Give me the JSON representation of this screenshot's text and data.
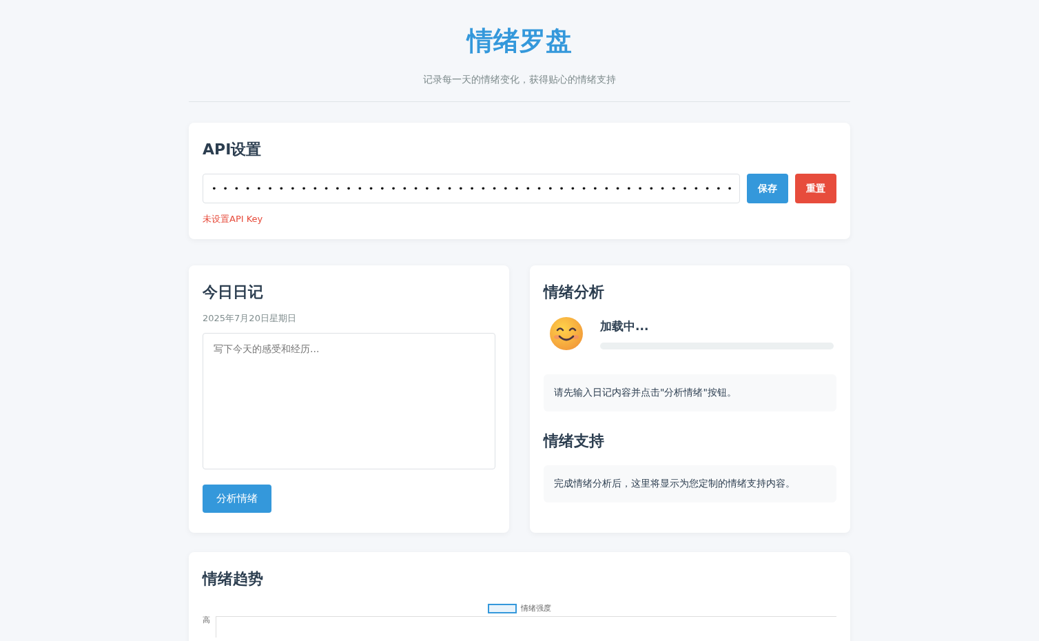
{
  "header": {
    "title": "情绪罗盘",
    "subtitle": "记录每一天的情绪变化，获得贴心的情绪支持"
  },
  "api_settings": {
    "title": "API设置",
    "key_field": {
      "value": "•••••••••••••••••••••••••••••••••••••••••••••••"
    },
    "buttons": [
      {
        "label": "保存",
        "kind": "primary"
      },
      {
        "label": "重置",
        "kind": "danger"
      }
    ],
    "status": "未设置API Key"
  },
  "diary": {
    "title": "今日日记",
    "date": "2025年7月20日星期日",
    "entry": {
      "placeholder": "写下今天的感受和经历..."
    },
    "button": "分析情绪"
  },
  "analysis": {
    "title": "情绪分析",
    "mood_label": "加载中...",
    "level": 0,
    "message": "请先输入日记内容并点击\"分析情绪\"按钮。"
  },
  "support": {
    "title": "情绪支持",
    "message": "完成情绪分析后，这里将显示为您定制的情绪支持内容。"
  },
  "trend": {
    "title": "情绪趋势",
    "legend": "情绪强度",
    "y_label": "高"
  }
}
